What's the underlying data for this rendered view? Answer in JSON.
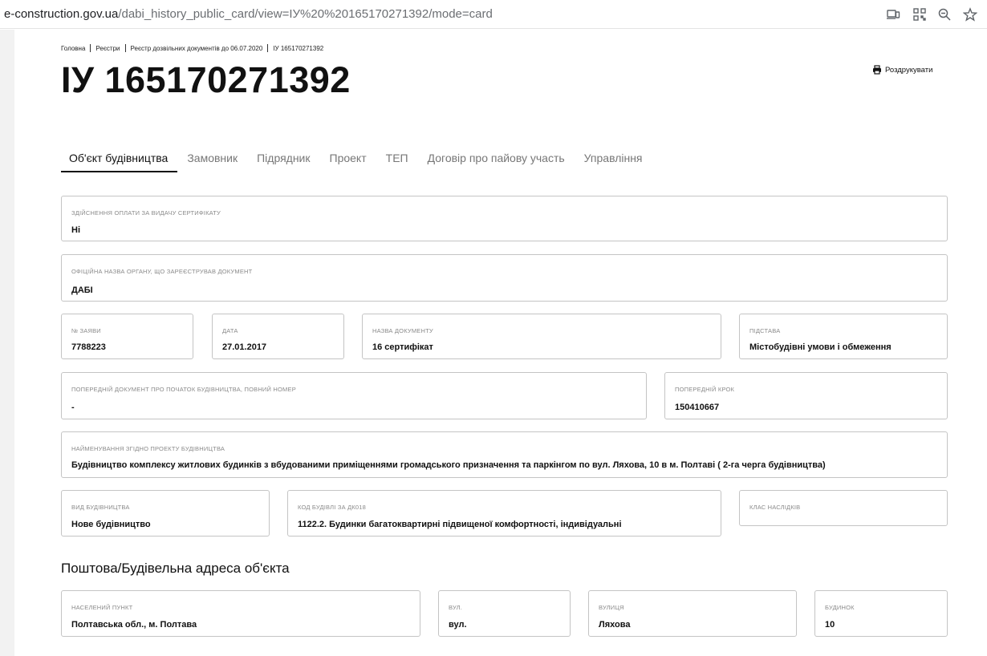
{
  "browser": {
    "url_host": "e-construction.gov.ua",
    "url_path": "/dabi_history_public_card/view=ІУ%20%20165170271392/mode=card",
    "icons": [
      "devices-icon",
      "qr-code-icon",
      "zoom-icon",
      "star-icon"
    ]
  },
  "breadcrumb": [
    "Головна",
    "Реєстри",
    "Реєстр дозвільних документів до 06.07.2020",
    "ІУ 165170271392"
  ],
  "title": "ІУ 165170271392",
  "print_label": "Роздрукувати",
  "tabs": [
    {
      "label": "Об'єкт будівництва",
      "active": true
    },
    {
      "label": "Замовник",
      "active": false
    },
    {
      "label": "Підрядник",
      "active": false
    },
    {
      "label": "Проект",
      "active": false
    },
    {
      "label": "ТЕП",
      "active": false
    },
    {
      "label": "Договір про пайову участь",
      "active": false
    },
    {
      "label": "Управління",
      "active": false
    }
  ],
  "fields": {
    "payment": {
      "label": "Здійснення оплати за видачу сертифікату",
      "value": "Ні"
    },
    "authority": {
      "label": "Офіційна назва органу, що зареєстрував документ",
      "value": "ДАБІ"
    },
    "application_no": {
      "label": "№ заяви",
      "value": "7788223"
    },
    "date": {
      "label": "Дата",
      "value": "27.01.2017"
    },
    "doc_name": {
      "label": "Назва документу",
      "value": "16 сертифікат"
    },
    "basis": {
      "label": "Підстава",
      "value": "Містобудівні умови і обмеження"
    },
    "prev_doc": {
      "label": "Попередній документ про початок будівництва, повний номер",
      "value": "-"
    },
    "prev_step": {
      "label": "Попередній крок",
      "value": "150410667"
    },
    "project_name": {
      "label": "Найменування згідно проекту будівництва",
      "value": "Будівництво комплексу житлових будинків з вбудованими приміщеннями громадського призначення та паркінгом по вул. Ляхова, 10 в м. Полтаві ( 2-га черга будівництва)"
    },
    "construction_type": {
      "label": "Вид будівництва",
      "value": "Нове будівництво"
    },
    "building_code": {
      "label": "Код будівлі за ДК018",
      "value": "1122.2. Будинки багатоквартирні підвищеної комфортності, індивідуальні"
    },
    "consequence_class": {
      "label": "Клас наслідків",
      "value": ""
    }
  },
  "address": {
    "title": "Поштова/Будівельна адреса об'єкта",
    "settlement": {
      "label": "Населений пункт",
      "value": "Полтавська обл., м. Полтава"
    },
    "street_type": {
      "label": "Вул.",
      "value": "вул."
    },
    "street": {
      "label": "Вулиця",
      "value": "Ляхова"
    },
    "building": {
      "label": "Будинок",
      "value": "10"
    }
  }
}
